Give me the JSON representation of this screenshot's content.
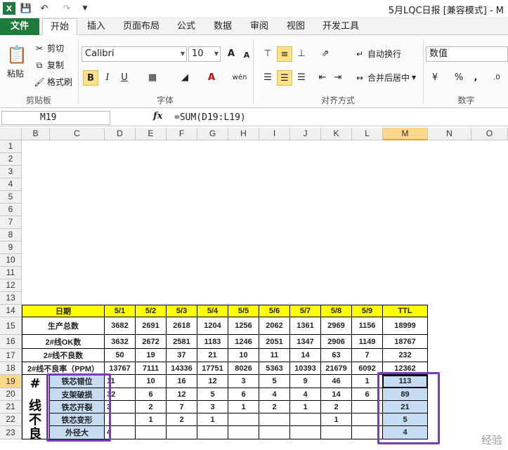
{
  "title_bar": {
    "title": "5月LQC日报  [兼容模式]  -  M",
    "quick_access": [
      "save-icon",
      "undo-icon",
      "redo-icon",
      "customize-icon"
    ]
  },
  "tabs": [
    "文件",
    "开始",
    "插入",
    "页面布局",
    "公式",
    "数据",
    "审阅",
    "视图",
    "开发工具"
  ],
  "ribbon": {
    "clipboard": {
      "paste": "粘贴",
      "cut": "剪切",
      "copy": "复制",
      "format_painter": "格式刷",
      "group": "剪贴板"
    },
    "font": {
      "name": "Calibri",
      "size": "10",
      "group": "字体",
      "bold": "B",
      "italic": "I",
      "underline": "U",
      "grow": "A",
      "shrink": "A"
    },
    "alignment": {
      "wrap": "自动换行",
      "merge": "合并后居中",
      "group": "对齐方式"
    },
    "number": {
      "format": "数值",
      "percent": "%",
      "comma": ",",
      "group": "数字"
    }
  },
  "formula_bar": {
    "name_box": "M19",
    "fx": "fx",
    "formula": "=SUM(D19:L19)"
  },
  "columns": [
    "B",
    "C",
    "D",
    "E",
    "F",
    "G",
    "H",
    "I",
    "J",
    "K",
    "L",
    "M",
    "N",
    "O"
  ],
  "rows": [
    "1",
    "2",
    "3",
    "4",
    "5",
    "6",
    "7",
    "8",
    "9",
    "10",
    "11",
    "12",
    "13",
    "14",
    "15",
    "16",
    "17",
    "18",
    "19",
    "20",
    "21",
    "22",
    "23"
  ],
  "table": {
    "header": [
      "日期",
      "5/1",
      "5/2",
      "5/3",
      "5/4",
      "5/5",
      "5/6",
      "5/7",
      "5/8",
      "5/9",
      "TTL"
    ],
    "rows": [
      [
        "生产总数",
        "3682",
        "2691",
        "2618",
        "1204",
        "1256",
        "2062",
        "1361",
        "2969",
        "1156",
        "18999"
      ],
      [
        "2#线OK数",
        "3632",
        "2672",
        "2581",
        "1183",
        "1246",
        "2051",
        "1347",
        "2906",
        "1149",
        "18767"
      ],
      [
        "2#线不良数",
        "50",
        "19",
        "37",
        "21",
        "10",
        "11",
        "14",
        "63",
        "7",
        "232"
      ],
      [
        "2#线不良率（PPM）",
        "13767",
        "7111",
        "14336",
        "17751",
        "8026",
        "5363",
        "10393",
        "21679",
        "6092",
        "12362"
      ]
    ],
    "defect_rows": [
      [
        "铁芯错位",
        "11",
        "10",
        "16",
        "12",
        "3",
        "5",
        "9",
        "46",
        "1",
        "113"
      ],
      [
        "支架破损",
        "32",
        "6",
        "12",
        "5",
        "6",
        "4",
        "4",
        "14",
        "6",
        "89"
      ],
      [
        "铁芯开裂",
        "3",
        "2",
        "7",
        "3",
        "1",
        "2",
        "1",
        "2",
        "",
        "21"
      ],
      [
        "铁芯变形",
        "",
        "1",
        "2",
        "1",
        "",
        "",
        "",
        "1",
        "",
        "5"
      ],
      [
        "外径大",
        "4",
        "",
        "",
        "",
        "",
        "",
        "",
        "",
        "",
        "4"
      ]
    ],
    "vertical_label": [
      "#",
      "线",
      "不",
      "良"
    ]
  },
  "watermark": "经验"
}
